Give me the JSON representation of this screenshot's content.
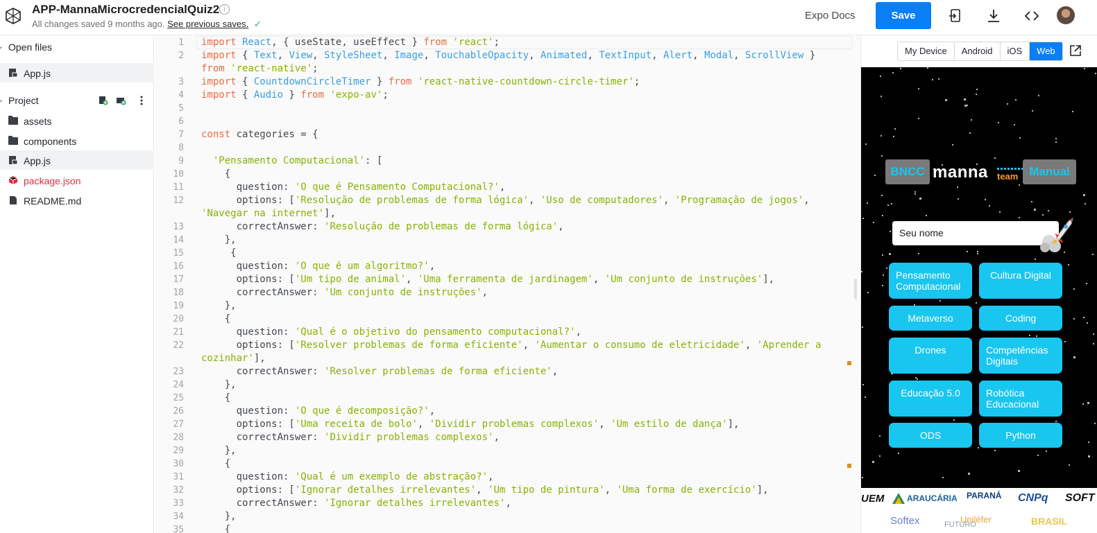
{
  "header": {
    "project_title": "APP-MannaMicrocredencialQuiz2",
    "info_glyph": "i",
    "saved_text": "All changes saved 9 months ago.",
    "previous_saves_link": "See previous saves.",
    "check_glyph": "✓",
    "docs_link": "Expo Docs",
    "save_label": "Save"
  },
  "sidebar": {
    "open_files_label": "Open files",
    "open_files": [
      {
        "name": "App.js"
      }
    ],
    "project_label": "Project",
    "project_items": [
      {
        "name": "assets",
        "type": "folder"
      },
      {
        "name": "components",
        "type": "folder"
      },
      {
        "name": "App.js",
        "type": "js",
        "active": true
      },
      {
        "name": "package.json",
        "type": "package"
      },
      {
        "name": "README.md",
        "type": "md"
      }
    ]
  },
  "editor": {
    "lines": [
      {
        "n": "1",
        "html": "<span class='k'>import</span> <span class='c'>React</span>, { useState, useEffect } <span class='k'>from</span> <span class='s'>'react'</span>;"
      },
      {
        "n": "2",
        "html": "<span class='k'>import</span> { <span class='c'>Text</span>, <span class='c'>View</span>, <span class='c'>StyleSheet</span>, <span class='c'>Image</span>, <span class='c'>TouchableOpacity</span>, <span class='c'>Animated</span>, <span class='c'>TextInput</span>, <span class='c'>Alert</span>, <span class='c'>Modal</span>, <span class='c'>ScrollView</span> }"
      },
      {
        "n": "",
        "html": "<span class='k'>from</span> <span class='s'>'react-native'</span>;"
      },
      {
        "n": "3",
        "html": "<span class='k'>import</span> { <span class='c'>CountdownCircleTimer</span> } <span class='k'>from</span> <span class='s'>'react-native-countdown-circle-timer'</span>;"
      },
      {
        "n": "4",
        "html": "<span class='k'>import</span> { <span class='c'>Audio</span> } <span class='k'>from</span> <span class='s'>'expo-av'</span>;"
      },
      {
        "n": "5",
        "html": ""
      },
      {
        "n": "6",
        "html": ""
      },
      {
        "n": "7",
        "html": "<span class='k'>const</span> categories = {"
      },
      {
        "n": "8",
        "html": ""
      },
      {
        "n": "9",
        "html": "  <span class='s'>'Pensamento Computacional'</span>: ["
      },
      {
        "n": "10",
        "html": "    {"
      },
      {
        "n": "11",
        "html": "      question: <span class='s'>'O que é Pensamento Computacional?'</span>,"
      },
      {
        "n": "12",
        "html": "      options: [<span class='s'>'Resolução de problemas de forma lógica'</span>, <span class='s'>'Uso de computadores'</span>, <span class='s'>'Programação de jogos'</span>,"
      },
      {
        "n": "",
        "html": "<span class='s'>'Navegar na internet'</span>],"
      },
      {
        "n": "13",
        "html": "      correctAnswer: <span class='s'>'Resolução de problemas de forma lógica'</span>,"
      },
      {
        "n": "14",
        "html": "    },"
      },
      {
        "n": "15",
        "html": "     {"
      },
      {
        "n": "16",
        "html": "      question: <span class='s'>'O que é um algoritmo?'</span>,"
      },
      {
        "n": "17",
        "html": "      options: [<span class='s'>'Um tipo de animal'</span>, <span class='s'>'Uma ferramenta de jardinagem'</span>, <span class='s'>'Um conjunto de instruções'</span>],"
      },
      {
        "n": "18",
        "html": "      correctAnswer: <span class='s'>'Um conjunto de instruções'</span>,"
      },
      {
        "n": "19",
        "html": "    },"
      },
      {
        "n": "20",
        "html": "    {"
      },
      {
        "n": "21",
        "html": "      question: <span class='s'>'Qual é o objetivo do pensamento computacional?'</span>,"
      },
      {
        "n": "22",
        "html": "      options: [<span class='s'>'Resolver problemas de forma eficiente'</span>, <span class='s'>'Aumentar o consumo de eletricidade'</span>, <span class='s'>'Aprender a</span>"
      },
      {
        "n": "",
        "html": "<span class='s'>cozinhar'</span>],"
      },
      {
        "n": "23",
        "html": "      correctAnswer: <span class='s'>'Resolver problemas de forma eficiente'</span>,"
      },
      {
        "n": "24",
        "html": "    },"
      },
      {
        "n": "25",
        "html": "    {"
      },
      {
        "n": "26",
        "html": "      question: <span class='s'>'O que é decomposição?'</span>,"
      },
      {
        "n": "27",
        "html": "      options: [<span class='s'>'Uma receita de bolo'</span>, <span class='s'>'Dividir problemas complexos'</span>, <span class='s'>'Um estilo de dança'</span>],"
      },
      {
        "n": "28",
        "html": "      correctAnswer: <span class='s'>'Dividir problemas complexos'</span>,"
      },
      {
        "n": "29",
        "html": "    },"
      },
      {
        "n": "30",
        "html": "    {"
      },
      {
        "n": "31",
        "html": "      question: <span class='s'>'Qual é um exemplo de abstração?'</span>,"
      },
      {
        "n": "32",
        "html": "      options: [<span class='s'>'Ignorar detalhes irrelevantes'</span>, <span class='s'>'Um tipo de pintura'</span>, <span class='s'>'Uma forma de exercício'</span>],"
      },
      {
        "n": "33",
        "html": "      correctAnswer: <span class='s'>'Ignorar detalhes irrelevantes'</span>,"
      },
      {
        "n": "34",
        "html": "    },"
      },
      {
        "n": "35",
        "html": "    {"
      }
    ]
  },
  "preview": {
    "platform_tabs": [
      "My Device",
      "Android",
      "iOS",
      "Web"
    ],
    "selected_platform": "Web",
    "app": {
      "bncc_label": "BNCC",
      "manna_logo": "manna",
      "team_logo": "team",
      "manual_label": "Manual",
      "name_placeholder": "Seu nome",
      "categories": [
        {
          "lines": [
            "Pensamento",
            "Computacional"
          ]
        },
        {
          "lines": [
            "Cultura Digital"
          ]
        },
        {
          "lines": [
            "Metaverso"
          ]
        },
        {
          "lines": [
            "Coding"
          ]
        },
        {
          "lines": [
            "Drones"
          ]
        },
        {
          "lines": [
            "Competências",
            "Digitais"
          ]
        },
        {
          "lines": [
            "Educação 5.0"
          ]
        },
        {
          "lines": [
            "Robótica",
            "Educacional"
          ]
        },
        {
          "lines": [
            "ODS"
          ]
        },
        {
          "lines": [
            "Python"
          ]
        }
      ]
    },
    "partner_logos": {
      "uem": "UEM",
      "araucaria": "ARAUCÁRIA",
      "parana": "PARANÁ",
      "cnpq": "CNPq",
      "soft": "SOFT",
      "softex": "Softex",
      "futuro": "FUTURO",
      "lefer": "Uniléfer",
      "brasil": "BRASIL"
    }
  },
  "colors": {
    "accent": "#0a7ff5",
    "app_button": "#19c6f0",
    "keyword": "#ed6a43",
    "string": "#86b300",
    "component": "#399ee6"
  }
}
